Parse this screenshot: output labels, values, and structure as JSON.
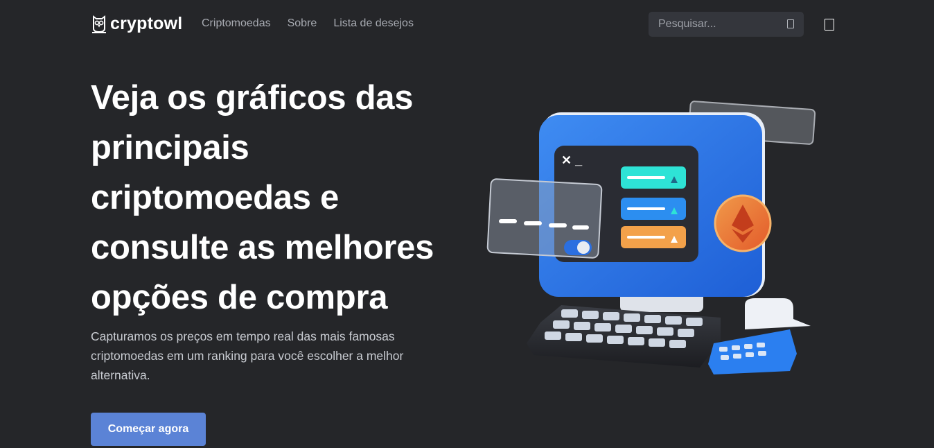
{
  "brand": {
    "name": "cryptowl",
    "icon": "owl-icon"
  },
  "nav": {
    "links": [
      "Criptomoedas",
      "Sobre",
      "Lista de desejos"
    ]
  },
  "search": {
    "placeholder": "Pesquisar...",
    "icon": "search-icon"
  },
  "theme_toggle": {
    "icon": "theme-toggle-icon"
  },
  "hero": {
    "title": "Veja os gráficos das principais criptomoedas e consulte as melhores opções de compra",
    "subtitle": "Capturamos os preços em tempo real das mais famosas criptomoedas em um ranking para você escolher a melhor alternativa.",
    "cta_label": "Começar agora"
  },
  "illustration": {
    "terminal_prompt": "✕ _",
    "coin_icon": "ethereum-icon"
  },
  "colors": {
    "background": "#252629",
    "accent": "#5b83d6",
    "nav_link": "#a8abb2",
    "search_bg": "#34363c"
  }
}
